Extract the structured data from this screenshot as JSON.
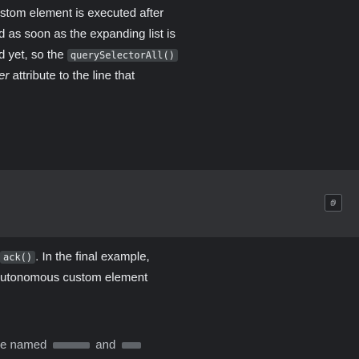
{
  "article": {
    "paragraph_1": {
      "line_1": "stom element is executed after",
      "line_2": "d as soon as the expanding list is",
      "line_3_start": "d yet, so the ",
      "line_3_code": "querySelectorAll()",
      "line_4_prefix": "er",
      "line_4_rest": " attribute to the line that"
    },
    "paragraph_2": {
      "line_1_code": "ack()",
      "line_1_rest": ". In the final example,",
      "line_2": "utonomous custom element"
    },
    "truncated_line": {
      "start": "e named",
      "middle": "and"
    }
  },
  "code_block": {
    "copy_icon": "copy-icon"
  },
  "colors": {
    "background": "#202124",
    "code_block_bg": "#303134",
    "inline_code_bg": "#3c4043",
    "text": "#e8eaed"
  }
}
